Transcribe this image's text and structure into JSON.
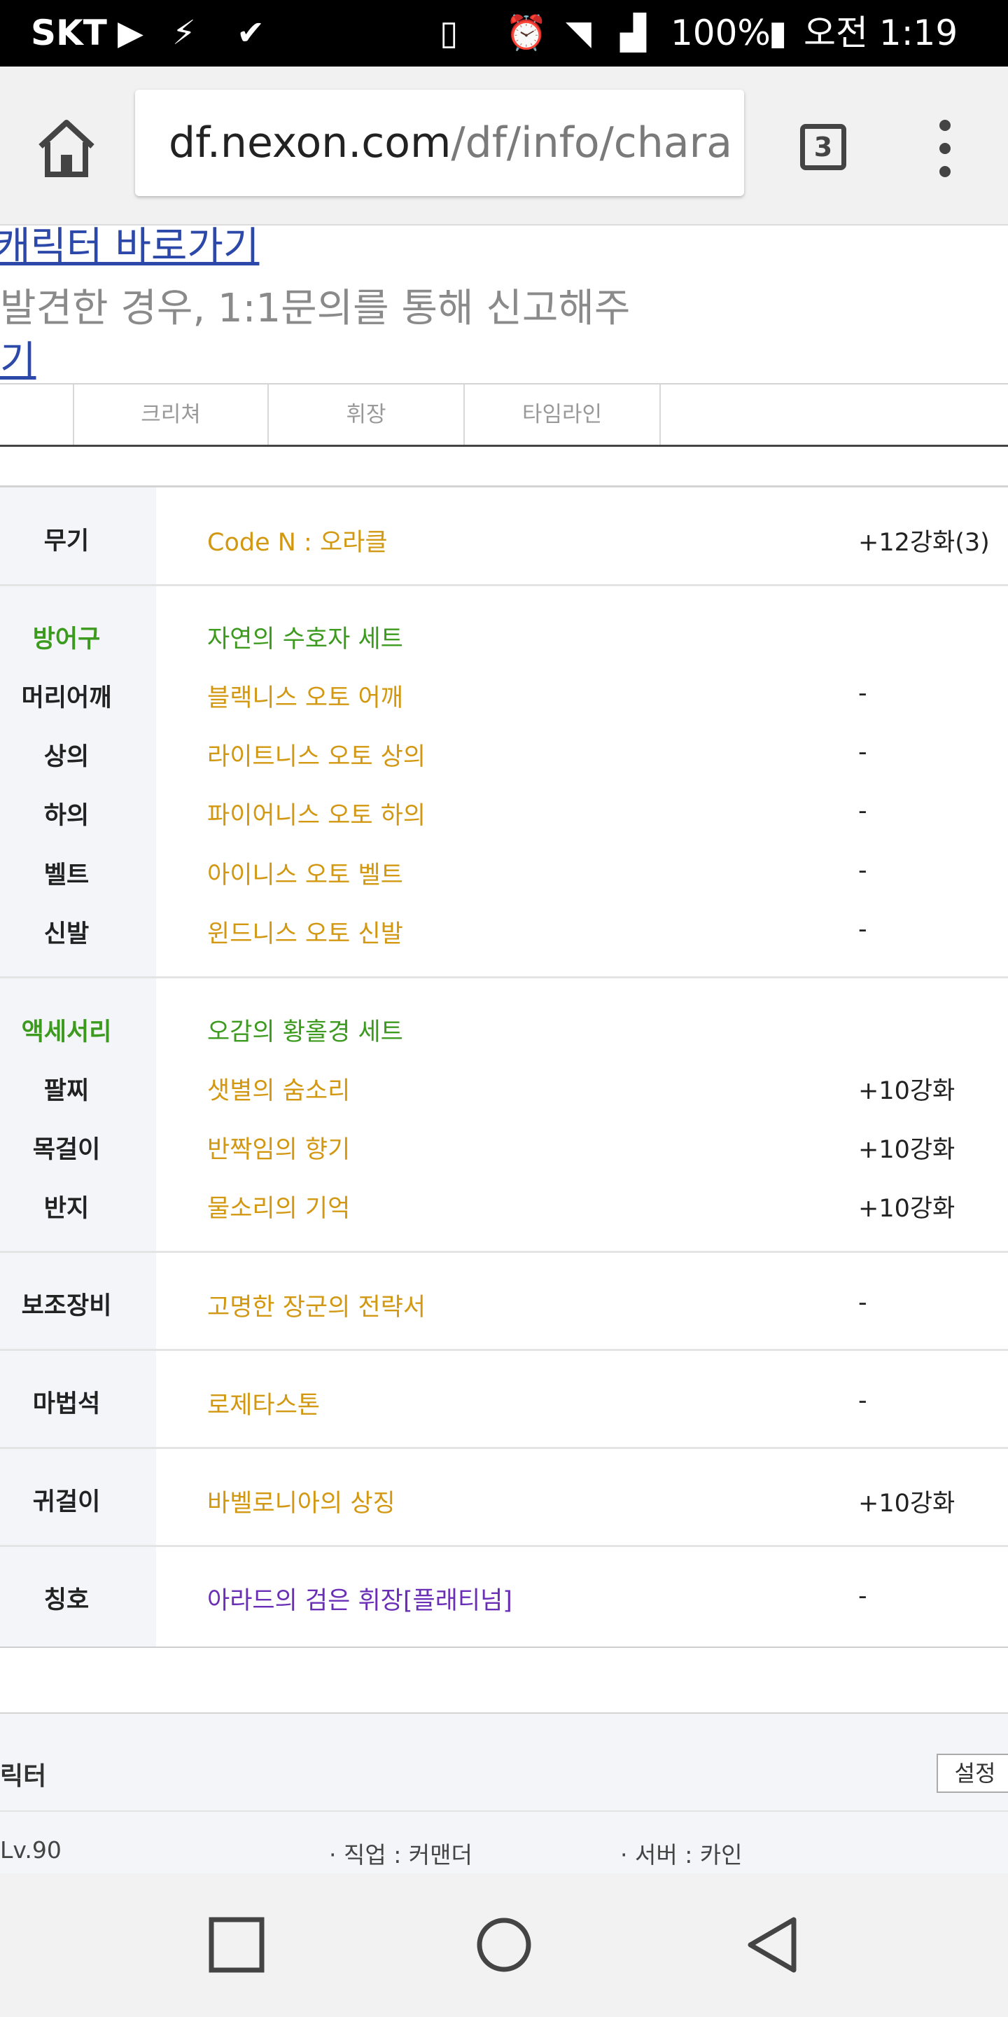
{
  "status_bar": {
    "carrier": "SKT",
    "battery": "100%",
    "time": "오전 1:19",
    "icons": [
      "play-icon",
      "app-icon",
      "app-check-icon",
      "vibrate-icon",
      "alarm-icon",
      "wifi-icon",
      "signal-icon",
      "battery-charging-icon"
    ]
  },
  "browser": {
    "url_host": "df.nexon.com",
    "url_path": "/df/info/chara",
    "tab_count": "3"
  },
  "page": {
    "link_top": "캐릭터 바로가기",
    "note_text": "발견한 경우, 1:1문의를 통해 신고해주",
    "link_bottom": "기",
    "tabs": [
      "",
      "크리쳐",
      "휘장",
      "타임라인"
    ]
  },
  "equipment": {
    "weapon": {
      "label": "무기",
      "name": "Code N : 오라클",
      "value": "+12강화(3)"
    },
    "armor_set": {
      "label": "방어구",
      "name": "자연의 수호자 세트"
    },
    "armor": [
      {
        "label": "머리어깨",
        "name": "블랙니스 오토 어깨",
        "value": "-"
      },
      {
        "label": "상의",
        "name": "라이트니스 오토 상의",
        "value": "-"
      },
      {
        "label": "하의",
        "name": "파이어니스 오토 하의",
        "value": "-"
      },
      {
        "label": "벨트",
        "name": "아이니스 오토 벨트",
        "value": "-"
      },
      {
        "label": "신발",
        "name": "윈드니스 오토 신발",
        "value": "-"
      }
    ],
    "accessory_set": {
      "label": "액세서리",
      "name": "오감의 황홀경 세트"
    },
    "accessories": [
      {
        "label": "팔찌",
        "name": "샛별의 숨소리",
        "value": "+10강화"
      },
      {
        "label": "목걸이",
        "name": "반짝임의 향기",
        "value": "+10강화"
      },
      {
        "label": "반지",
        "name": "물소리의 기억",
        "value": "+10강화"
      }
    ],
    "sub": {
      "label": "보조장비",
      "name": "고명한 장군의 전략서",
      "value": "-"
    },
    "magic_stone": {
      "label": "마법석",
      "name": "로제타스톤",
      "value": "-"
    },
    "earring": {
      "label": "귀걸이",
      "name": "바벨로니아의 상징",
      "value": "+10강화"
    },
    "title": {
      "label": "칭호",
      "name": "아라드의 검은 휘장[플래티넘]",
      "value": "-"
    }
  },
  "character_section": {
    "title": "릭터",
    "settings_label": "설정",
    "level": "Lv.90",
    "job": "· 직업 : 커맨더",
    "server": "· 서버 : 카인"
  },
  "colors": {
    "item_gold": "#d39812",
    "set_green": "#3c9a1e",
    "title_purple": "#6a2fb6",
    "link_blue": "#2c48a8"
  }
}
